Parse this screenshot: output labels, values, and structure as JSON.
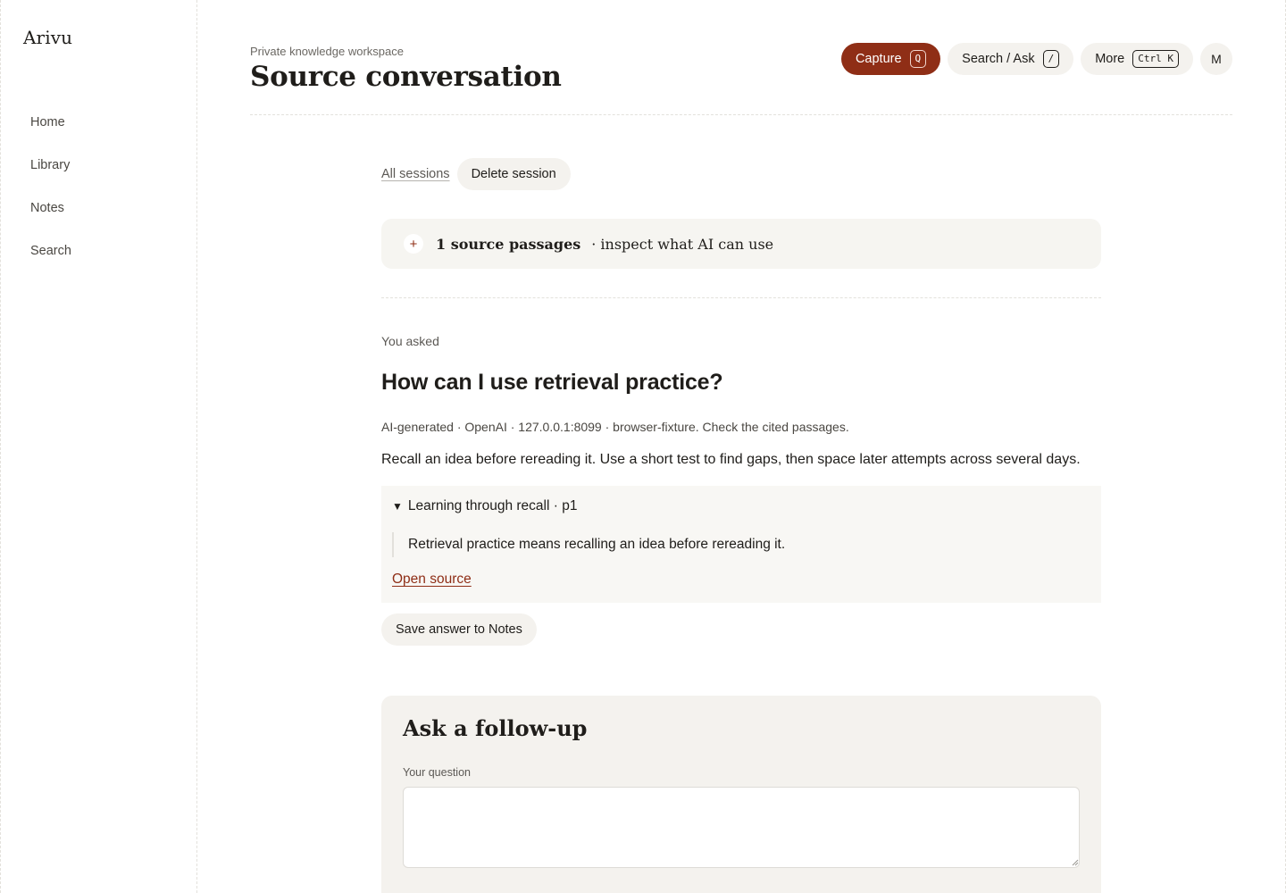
{
  "brand": "Arivu",
  "nav": [
    "Home",
    "Library",
    "Notes",
    "Search"
  ],
  "header": {
    "eyebrow": "Private knowledge workspace",
    "title": "Source conversation",
    "capture": {
      "label": "Capture",
      "key": "Q"
    },
    "search": {
      "label": "Search / Ask",
      "key": "/"
    },
    "more": {
      "label": "More",
      "key": "Ctrl K"
    },
    "avatar": "M"
  },
  "session": {
    "all_sessions": "All sessions",
    "delete": "Delete session"
  },
  "sources": {
    "count_label": "1 source passages",
    "hint": "· inspect what AI can use"
  },
  "conversation": {
    "asked_label": "You asked",
    "question": "How can I use retrieval practice?",
    "meta": "AI-generated · OpenAI · 127.0.0.1:8099 · browser-fixture. Check the cited passages.",
    "answer": "Recall an idea before rereading it. Use a short test to find gaps, then space later attempts across several days.",
    "citation": {
      "title": "Learning through recall · p1",
      "quote": "Retrieval practice means recalling an idea before rereading it.",
      "open_link": "Open source"
    },
    "save_button": "Save answer to Notes"
  },
  "followup": {
    "title": "Ask a follow-up",
    "field_label": "Your question",
    "value": ""
  },
  "colors": {
    "accent": "#8f2e16",
    "surface": "#f4f2ee",
    "text": "#1f1d1a"
  }
}
